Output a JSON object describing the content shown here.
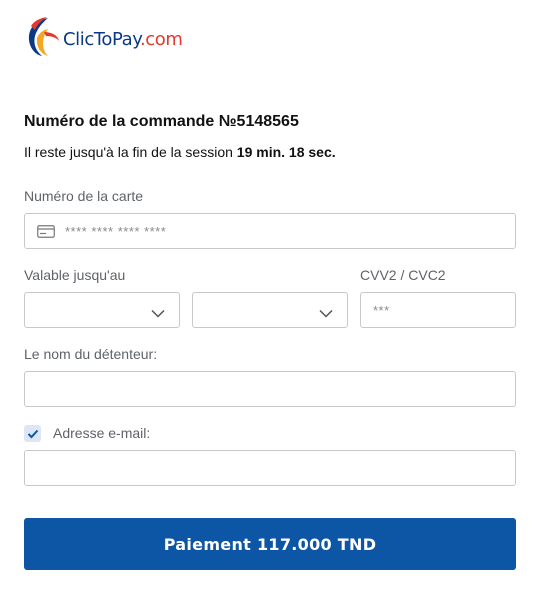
{
  "brand": {
    "name": "ClicToPay",
    "tld": ".com",
    "colors": {
      "navy": "#0b3a83",
      "red": "#e5382c",
      "orange": "#f5a623",
      "button": "#0d56a6"
    }
  },
  "order": {
    "title": "Numéro de la commande №5148565"
  },
  "session": {
    "prefix": "Il reste jusqu'à la fin de la session",
    "time": "19 min. 18 sec."
  },
  "card": {
    "label": "Numéro de la carte",
    "placeholder": "**** **** **** ****",
    "icon": "credit-card-icon"
  },
  "expiry": {
    "label": "Valable jusqu'au",
    "month_value": "",
    "year_value": "",
    "icon": "chevron-down-icon"
  },
  "cvv": {
    "label": "CVV2 / CVC2",
    "placeholder": "***"
  },
  "holder": {
    "label": "Le nom du détenteur:",
    "value": ""
  },
  "email": {
    "checkbox_checked": true,
    "label": "Adresse e-mail:",
    "value": ""
  },
  "submit": {
    "label": "Paiement 117.000 TND"
  }
}
